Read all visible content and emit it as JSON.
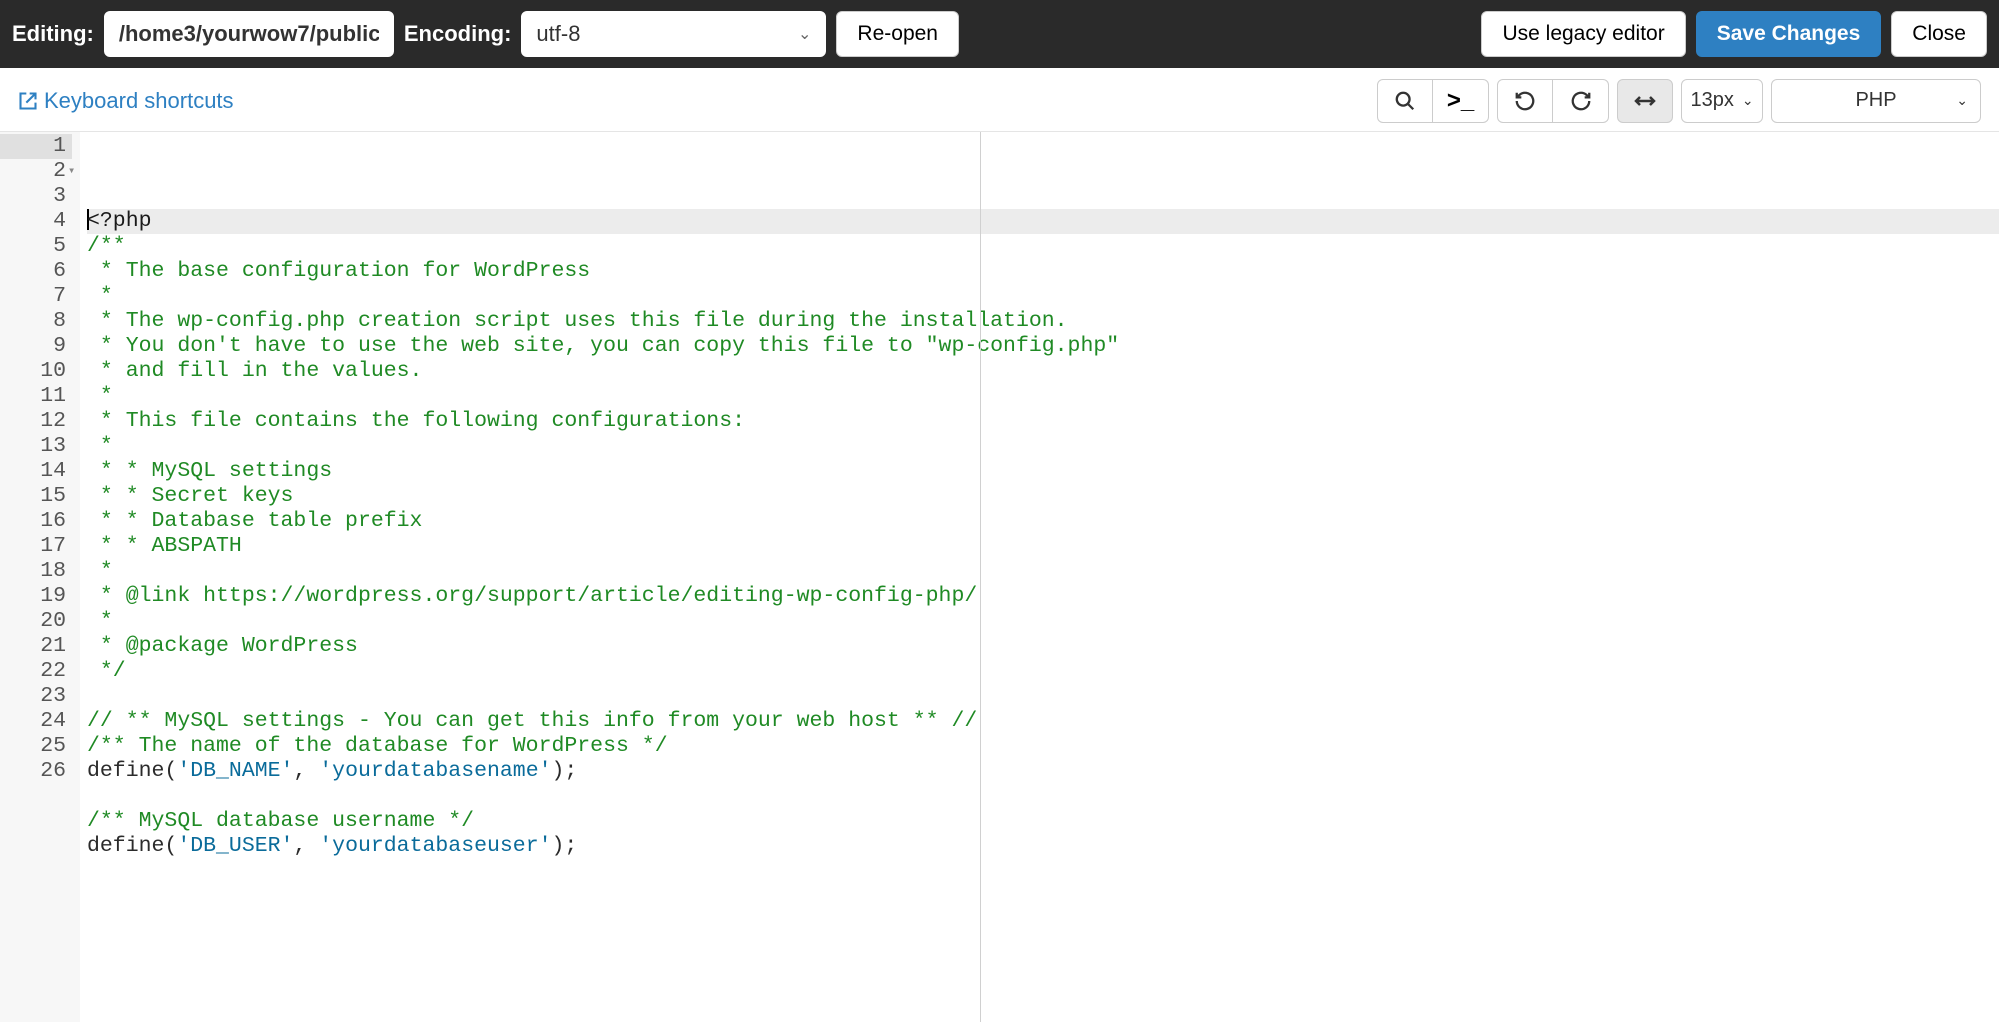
{
  "topbar": {
    "editing_label": "Editing:",
    "path_value": "/home3/yourwow7/public",
    "encoding_label": "Encoding:",
    "encoding_value": "utf-8",
    "reopen_label": "Re-open",
    "legacy_label": "Use legacy editor",
    "save_label": "Save Changes",
    "close_label": "Close"
  },
  "subbar": {
    "shortcuts_label": "Keyboard shortcuts",
    "font_size_label": "13px",
    "language_label": "PHP"
  },
  "code": {
    "lines": [
      {
        "n": 1,
        "hl": true,
        "segments": [
          {
            "cls": "c-phptag",
            "t": "<?php",
            "cursor_after": 0
          }
        ]
      },
      {
        "n": 2,
        "fold": true,
        "segments": [
          {
            "cls": "c-comment",
            "t": "/**"
          }
        ]
      },
      {
        "n": 3,
        "segments": [
          {
            "cls": "c-comment",
            "t": " * The base configuration for WordPress"
          }
        ]
      },
      {
        "n": 4,
        "segments": [
          {
            "cls": "c-comment",
            "t": " *"
          }
        ]
      },
      {
        "n": 5,
        "segments": [
          {
            "cls": "c-comment",
            "t": " * The wp-config.php creation script uses this file during the installation."
          }
        ]
      },
      {
        "n": 6,
        "segments": [
          {
            "cls": "c-comment",
            "t": " * You don't have to use the web site, you can copy this file to \"wp-config.php\""
          }
        ]
      },
      {
        "n": 7,
        "segments": [
          {
            "cls": "c-comment",
            "t": " * and fill in the values."
          }
        ]
      },
      {
        "n": 8,
        "segments": [
          {
            "cls": "c-comment",
            "t": " *"
          }
        ]
      },
      {
        "n": 9,
        "segments": [
          {
            "cls": "c-comment",
            "t": " * This file contains the following configurations:"
          }
        ]
      },
      {
        "n": 10,
        "segments": [
          {
            "cls": "c-comment",
            "t": " *"
          }
        ]
      },
      {
        "n": 11,
        "segments": [
          {
            "cls": "c-comment",
            "t": " * * MySQL settings"
          }
        ]
      },
      {
        "n": 12,
        "segments": [
          {
            "cls": "c-comment",
            "t": " * * Secret keys"
          }
        ]
      },
      {
        "n": 13,
        "segments": [
          {
            "cls": "c-comment",
            "t": " * * Database table prefix"
          }
        ]
      },
      {
        "n": 14,
        "segments": [
          {
            "cls": "c-comment",
            "t": " * * ABSPATH"
          }
        ]
      },
      {
        "n": 15,
        "segments": [
          {
            "cls": "c-comment",
            "t": " *"
          }
        ]
      },
      {
        "n": 16,
        "segments": [
          {
            "cls": "c-comment",
            "t": " * @link https://wordpress.org/support/article/editing-wp-config-php/"
          }
        ]
      },
      {
        "n": 17,
        "segments": [
          {
            "cls": "c-comment",
            "t": " *"
          }
        ]
      },
      {
        "n": 18,
        "segments": [
          {
            "cls": "c-comment",
            "t": " * @package WordPress"
          }
        ]
      },
      {
        "n": 19,
        "segments": [
          {
            "cls": "c-comment",
            "t": " */"
          }
        ]
      },
      {
        "n": 20,
        "segments": [
          {
            "cls": "",
            "t": ""
          }
        ]
      },
      {
        "n": 21,
        "segments": [
          {
            "cls": "c-comment",
            "t": "// ** MySQL settings - You can get this info from your web host ** //"
          }
        ]
      },
      {
        "n": 22,
        "segments": [
          {
            "cls": "c-comment",
            "t": "/** The name of the database for WordPress */"
          }
        ]
      },
      {
        "n": 23,
        "segments": [
          {
            "cls": "c-funcname",
            "t": "define("
          },
          {
            "cls": "c-string",
            "t": "'DB_NAME'"
          },
          {
            "cls": "c-funcname",
            "t": ", "
          },
          {
            "cls": "c-string",
            "t": "'yourdatabasename'"
          },
          {
            "cls": "c-funcname",
            "t": ");"
          }
        ]
      },
      {
        "n": 24,
        "segments": [
          {
            "cls": "",
            "t": ""
          }
        ]
      },
      {
        "n": 25,
        "segments": [
          {
            "cls": "c-comment",
            "t": "/** MySQL database username */"
          }
        ]
      },
      {
        "n": 26,
        "segments": [
          {
            "cls": "c-funcname",
            "t": "define("
          },
          {
            "cls": "c-string",
            "t": "'DB_USER'"
          },
          {
            "cls": "c-funcname",
            "t": ", "
          },
          {
            "cls": "c-string",
            "t": "'yourdatabaseuser'"
          },
          {
            "cls": "c-funcname",
            "t": ");"
          }
        ]
      }
    ]
  }
}
